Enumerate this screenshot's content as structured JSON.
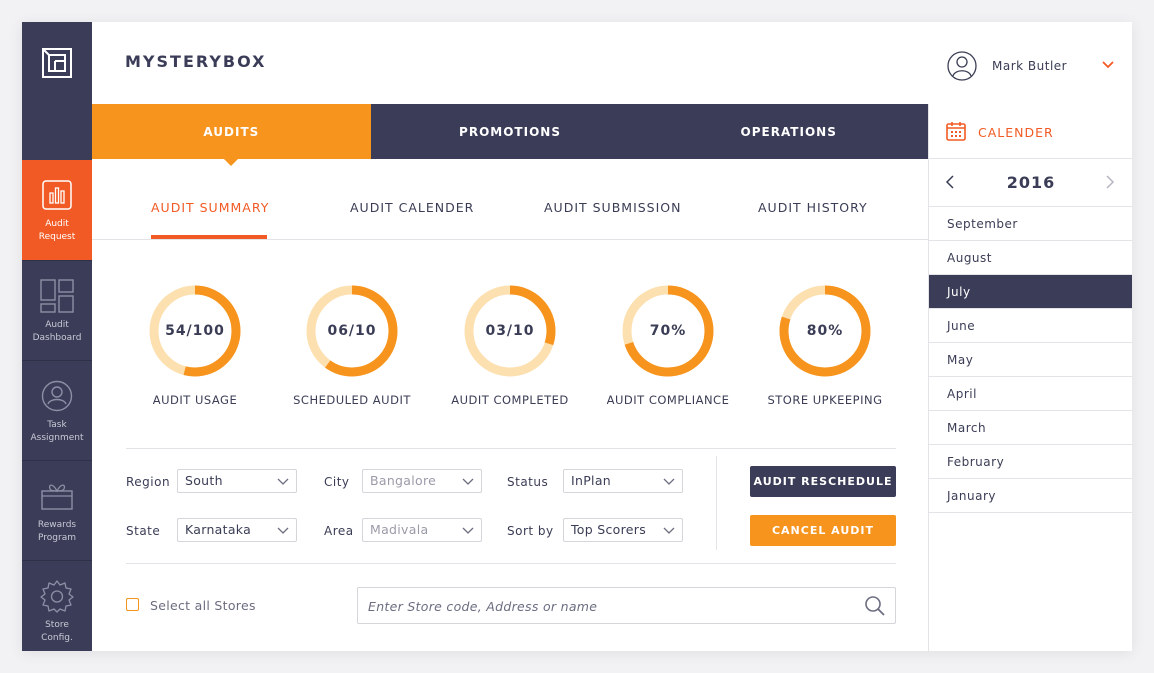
{
  "brand": "MYSTERYBOX",
  "user": {
    "name": "Mark Butler"
  },
  "sidebar": {
    "items": [
      {
        "label": "Audit\nRequest",
        "icon": "bar-chart-icon",
        "active": true
      },
      {
        "label": "Audit\nDashboard",
        "icon": "dashboard-grid-icon",
        "active": false
      },
      {
        "label": "Task\nAssignment",
        "icon": "person-icon",
        "active": false
      },
      {
        "label": "Rewards\nProgram",
        "icon": "gift-icon",
        "active": false
      },
      {
        "label": "Store\nConfig.",
        "icon": "gear-icon",
        "active": false
      }
    ]
  },
  "main_nav": {
    "tabs": [
      {
        "label": "AUDITS",
        "active": true
      },
      {
        "label": "PROMOTIONS",
        "active": false
      },
      {
        "label": "OPERATIONS",
        "active": false
      }
    ]
  },
  "sub_tabs": [
    {
      "label": "AUDIT SUMMARY",
      "active": true
    },
    {
      "label": "AUDIT CALENDER",
      "active": false
    },
    {
      "label": "AUDIT SUBMISSION",
      "active": false
    },
    {
      "label": "AUDIT HISTORY",
      "active": false
    }
  ],
  "gauges": [
    {
      "value": "54/100",
      "label": "AUDIT USAGE",
      "fraction": 0.54
    },
    {
      "value": "06/10",
      "label": "SCHEDULED AUDIT",
      "fraction": 0.6
    },
    {
      "value": "03/10",
      "label": "AUDIT COMPLETED",
      "fraction": 0.3
    },
    {
      "value": "70%",
      "label": "AUDIT COMPLIANCE",
      "fraction": 0.7
    },
    {
      "value": "80%",
      "label": "STORE UPKEEPING",
      "fraction": 0.8
    }
  ],
  "filters": {
    "region": {
      "label": "Region",
      "value": "South"
    },
    "city": {
      "label": "City",
      "value": "Bangalore"
    },
    "status": {
      "label": "Status",
      "value": "InPlan"
    },
    "state": {
      "label": "State",
      "value": "Karnataka"
    },
    "area": {
      "label": "Area",
      "value": "Madivala"
    },
    "sort_by": {
      "label": "Sort by",
      "value": "Top Scorers"
    }
  },
  "buttons": {
    "reschedule": "AUDIT RESCHEDULE",
    "cancel": "CANCEL AUDIT"
  },
  "select_all": {
    "label": "Select all Stores",
    "checked": false
  },
  "search": {
    "placeholder": "Enter Store code, Address or name"
  },
  "calendar": {
    "title": "CALENDER",
    "year": "2016",
    "months": [
      "September",
      "August",
      "July",
      "June",
      "May",
      "April",
      "March",
      "February",
      "January"
    ],
    "selected_month": "July"
  },
  "colors": {
    "navy": "#3b3d58",
    "orange": "#f7941d",
    "red_orange": "#f15a24",
    "gauge_track": "#fde0b0"
  }
}
